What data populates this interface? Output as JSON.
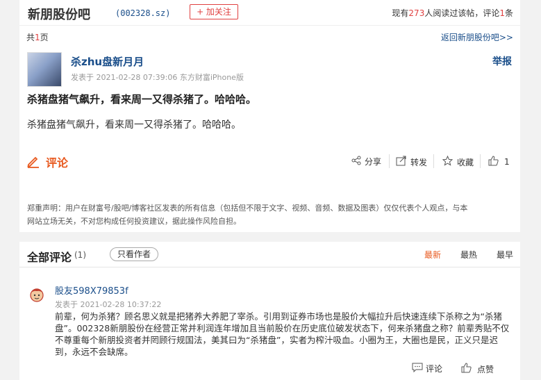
{
  "header": {
    "bar_name": "新朋股份吧",
    "stock_code": "(002328.sz)",
    "follow_label": "+ 加关注",
    "stats_prefix": "现有",
    "reader_count": "273",
    "stats_mid": "人阅读过该帖，评论",
    "comment_count": "1",
    "stats_suffix": "条"
  },
  "pagination": {
    "pages_prefix": "共",
    "pages": "1",
    "pages_suffix": "页",
    "back_link": "返回新朋股份吧>>"
  },
  "post": {
    "author": "杀zhu盘新月月",
    "time": "发表于 2021-02-28 07:39:06 东方财富iPhone版",
    "report": "举报",
    "title": "杀猪盘猪气飙升，看来周一又得杀猪了。哈哈哈。",
    "body": "杀猪盘猪气飙升，看来周一又得杀猪了。哈哈哈。",
    "comment_label": "评论",
    "actions": {
      "share": "分享",
      "forward": "转发",
      "collect": "收藏",
      "like_count": "1"
    },
    "disclaimer_line1": "郑重声明：用户在财富号/股吧/博客社区发表的所有信息（包括但不限于文字、视频、音频、数据及图表）仅仅代表个人观点，与本",
    "disclaimer_line2": "网站立场无关，不对您构成任何投资建议，据此操作风险自担。"
  },
  "comments": {
    "heading": "全部评论",
    "count": "(1)",
    "only_author": "只看作者",
    "sort": [
      "最新",
      "最热",
      "最早"
    ],
    "items": [
      {
        "user": "股友598X79853f",
        "time": "发表于 2021-02-28 10:37:22",
        "body": "前辈，何为杀猪？顾名思义就是把猪养大养肥了宰杀。引用到证券市场也是股价大幅拉升后快速连续下杀称之为“杀猪盘”。002328新朋股份在经营正常并利润连年增加且当前股价在历史底位破发状态下，何来杀猪盘之称？前辈秀贴不仅不尊重每个新朋投资者并罔顾行规国法，美其曰为“杀猪盘”，实者为榨汁吸血。小圈为王，大圈也是民，正义只是迟到，永远不会缺席。",
        "comment_label": "评论",
        "like_label": "点赞"
      }
    ]
  },
  "colors": {
    "link_blue": "#1a4e8a",
    "accent_orange": "#e85a20",
    "accent_red": "#e04040"
  }
}
